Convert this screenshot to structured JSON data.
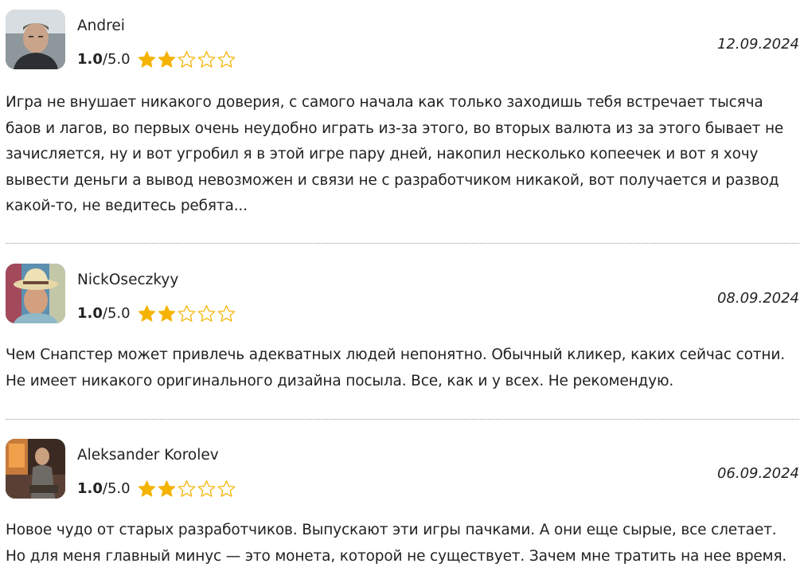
{
  "reviews": [
    {
      "author": "Andrei",
      "rating": "1.0",
      "rating_max": "/5.0",
      "stars_filled": 2,
      "stars_total": 5,
      "date": "12.09.2024",
      "avatar": "avatar-photo",
      "text_lines": [
        "Игра не внушает никакого доверия, с самого начала как только заходишь тебя встречает тысяча",
        "баов и лагов, во первых очень неудобно играть из-за этого, во вторых валюта из за этого бывает не",
        "зачисляется, ну и вот угробил я в этой игре пару дней, накопил несколько копеечек и вот я хочу",
        "вывести деньги а вывод невозможен и связи не с разработчиком никакой, вот получается и развод",
        "какой-то, не ведитесь ребята..."
      ]
    },
    {
      "author": "NickOseczkyy",
      "rating": "1.0",
      "rating_max": "/5.0",
      "stars_filled": 2,
      "stars_total": 5,
      "date": "08.09.2024",
      "avatar": "avatar-photo",
      "text_lines": [
        "Чем Снапстер может привлечь адекватных людей непонятно. Обычный кликер, каких сейчас сотни.",
        "Не имеет никакого оригинального дизайна посыла. Все, как и у всех. Не рекомендую."
      ]
    },
    {
      "author": "Aleksander Korolev",
      "rating": "1.0",
      "rating_max": "/5.0",
      "stars_filled": 2,
      "stars_total": 5,
      "date": "06.09.2024",
      "avatar": "avatar-photo",
      "text_lines": [
        "Новое чудо от старых разработчиков. Выпускают эти игры пачками. А они еще сырые, все слетает.",
        "Но для меня главный минус — это монета, которой не существует. Зачем мне тратить на нее время."
      ]
    }
  ],
  "colors": {
    "star_filled": "#f5b301",
    "star_empty_stroke": "#f5b301",
    "text": "#222222",
    "divider": "#9a9a9a"
  },
  "icons": {
    "star_filled": "star-filled-icon",
    "star_empty": "star-outline-icon"
  }
}
